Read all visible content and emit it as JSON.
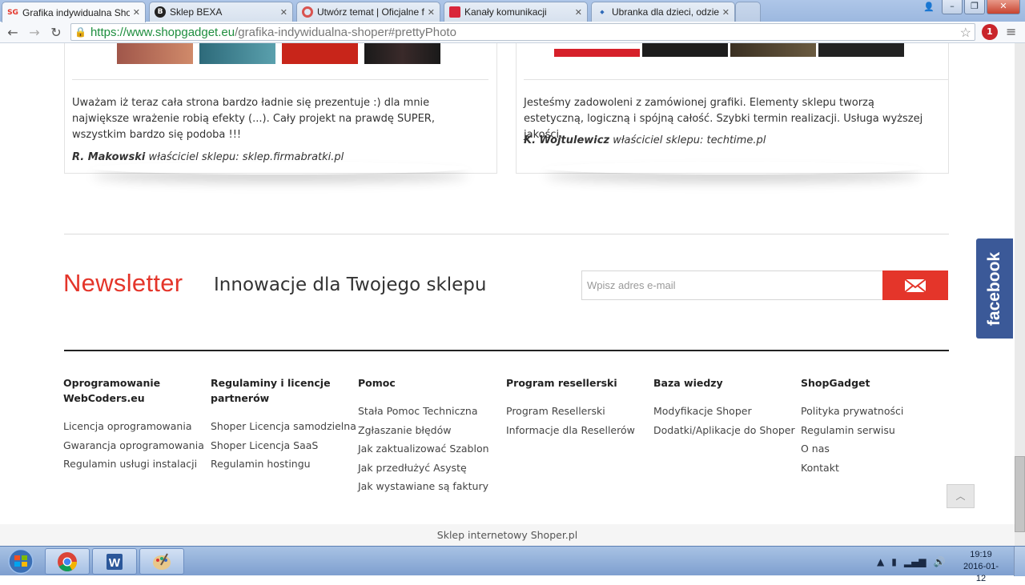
{
  "browser": {
    "tabs": [
      {
        "label": "Grafika indywidualna Shop",
        "favicon": "SG",
        "active": true
      },
      {
        "label": "Sklep BEXA",
        "favicon": "B",
        "active": false
      },
      {
        "label": "Utwórz temat | Oficjalne fo",
        "favicon": "lifebuoy",
        "active": false
      },
      {
        "label": "Kanały komunikacji",
        "favicon": "kanaly",
        "active": false
      },
      {
        "label": "Ubranka dla dzieci, odzież",
        "favicon": "shop",
        "active": false
      }
    ],
    "url_scheme": "https://",
    "url_host": "www.shopgadget.eu",
    "url_path": "/grafika-indywidualna-shoper#prettyPhoto",
    "extension_badge": "1"
  },
  "testimonials": [
    {
      "quote": "Uważam iż teraz cała strona bardzo ładnie się prezentuje :) dla mnie największe wrażenie robią efekty (...). Cały projekt na prawdę SUPER, wszystkim bardzo się podoba !!!",
      "author_name": "R. Makowski",
      "author_role": "właściciel sklepu: sklep.firmabratki.pl"
    },
    {
      "quote": "Jesteśmy zadowoleni z zamówionej grafiki. Elementy sklepu tworzą estetyczną, logiczną i spójną całość. Szybki termin realizacji. Usługa wyższej jakości.",
      "author_name": "K. Wojtulewicz",
      "author_role": "właściciel sklepu: techtime.pl"
    }
  ],
  "newsletter": {
    "title": "Newsletter",
    "subtitle": "Innowacje dla Twojego sklepu",
    "placeholder": "Wpisz adres e-mail",
    "button_icon": "envelope-icon"
  },
  "footer_columns": [
    {
      "title": "Oprogramowanie WebCoders.eu",
      "links": [
        "Licencja oprogramowania",
        "Gwarancja oprogramowania",
        "Regulamin usługi instalacji"
      ]
    },
    {
      "title": "Regulaminy i licencje partnerów",
      "links": [
        "Shoper Licencja samodzielna",
        "Shoper Licencja SaaS",
        "Regulamin hostingu"
      ]
    },
    {
      "title": "Pomoc",
      "links": [
        "Stała Pomoc Techniczna",
        "Zgłaszanie błędów",
        "Jak zaktualizować Szablon",
        "Jak przedłużyć Asystę",
        "Jak wystawiane są faktury"
      ]
    },
    {
      "title": "Program resellerski",
      "links": [
        "Program Resellerski",
        "Informacje dla Resellerów"
      ]
    },
    {
      "title": "Baza wiedzy",
      "links": [
        "Modyfikacje Shoper",
        "Dodatki/Aplikacje do Shoper"
      ]
    },
    {
      "title": "ShopGadget",
      "links": [
        "Polityka prywatności",
        "Regulamin serwisu",
        "O nas",
        "Kontakt"
      ]
    }
  ],
  "footer_bar": "Sklep internetowy Shoper.pl",
  "facebook_label": "facebook",
  "taskbar": {
    "time": "19:19",
    "date": "2016-01-12"
  },
  "colors": {
    "accent": "#e4352a",
    "facebook": "#3b5998"
  }
}
